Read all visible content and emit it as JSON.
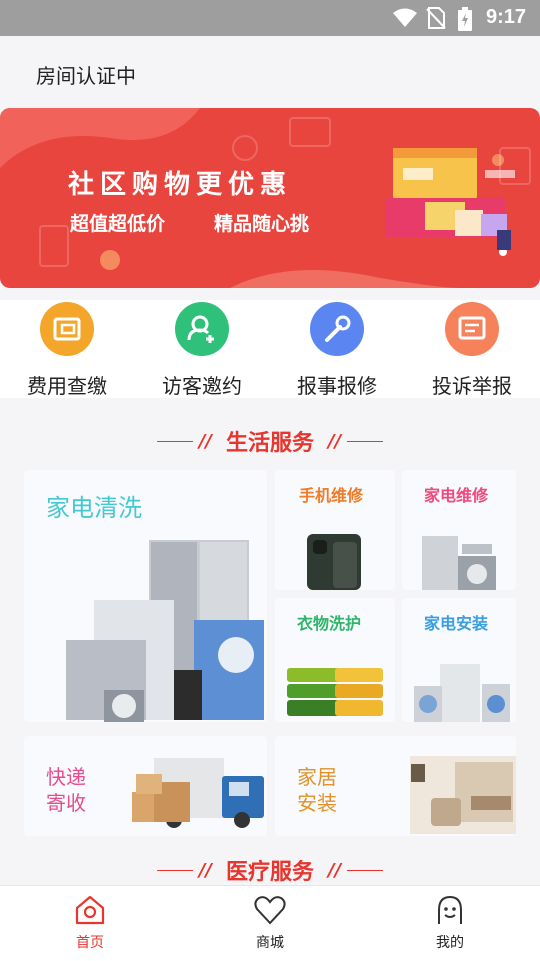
{
  "status_bar": {
    "time": "9:17",
    "icons": [
      "wifi-icon",
      "no-sim-icon",
      "battery-icon"
    ]
  },
  "header": {
    "title": "房间认证中"
  },
  "banner": {
    "headline": "社区购物更优惠",
    "tag1": "超值超低价",
    "tag2": "精品随心挑"
  },
  "quick_actions": [
    {
      "label": "费用查缴",
      "icon": "wallet-icon",
      "color": "#f4a62a"
    },
    {
      "label": "访客邀约",
      "icon": "add-user-icon",
      "color": "#2fc17a"
    },
    {
      "label": "报事报修",
      "icon": "wrench-icon",
      "color": "#5b85f0"
    },
    {
      "label": "投诉举报",
      "icon": "message-icon",
      "color": "#f5825b"
    }
  ],
  "life_services": {
    "title": "生活服务",
    "items": [
      {
        "label": "家电清洗",
        "color": "#44c9d3"
      },
      {
        "label": "手机维修",
        "color": "#f07b28"
      },
      {
        "label": "家电维修",
        "color": "#ef4a7d"
      },
      {
        "label": "衣物洗护",
        "color": "#2fb56b"
      },
      {
        "label": "家电安装",
        "color": "#3a9ee0"
      },
      {
        "label": "快递\n寄收",
        "color": "#e84c8b"
      },
      {
        "label": "家居\n安装",
        "color": "#e2922a"
      }
    ]
  },
  "medical_services": {
    "title": "医疗服务"
  },
  "bottom_nav": [
    {
      "label": "首页",
      "icon": "home-icon",
      "active": true
    },
    {
      "label": "商城",
      "icon": "heart-icon",
      "active": false
    },
    {
      "label": "我的",
      "icon": "profile-icon",
      "active": false
    }
  ],
  "colors": {
    "accent": "#e8352d",
    "banner": "#e9453f",
    "status_bar": "#9e9e9e"
  }
}
